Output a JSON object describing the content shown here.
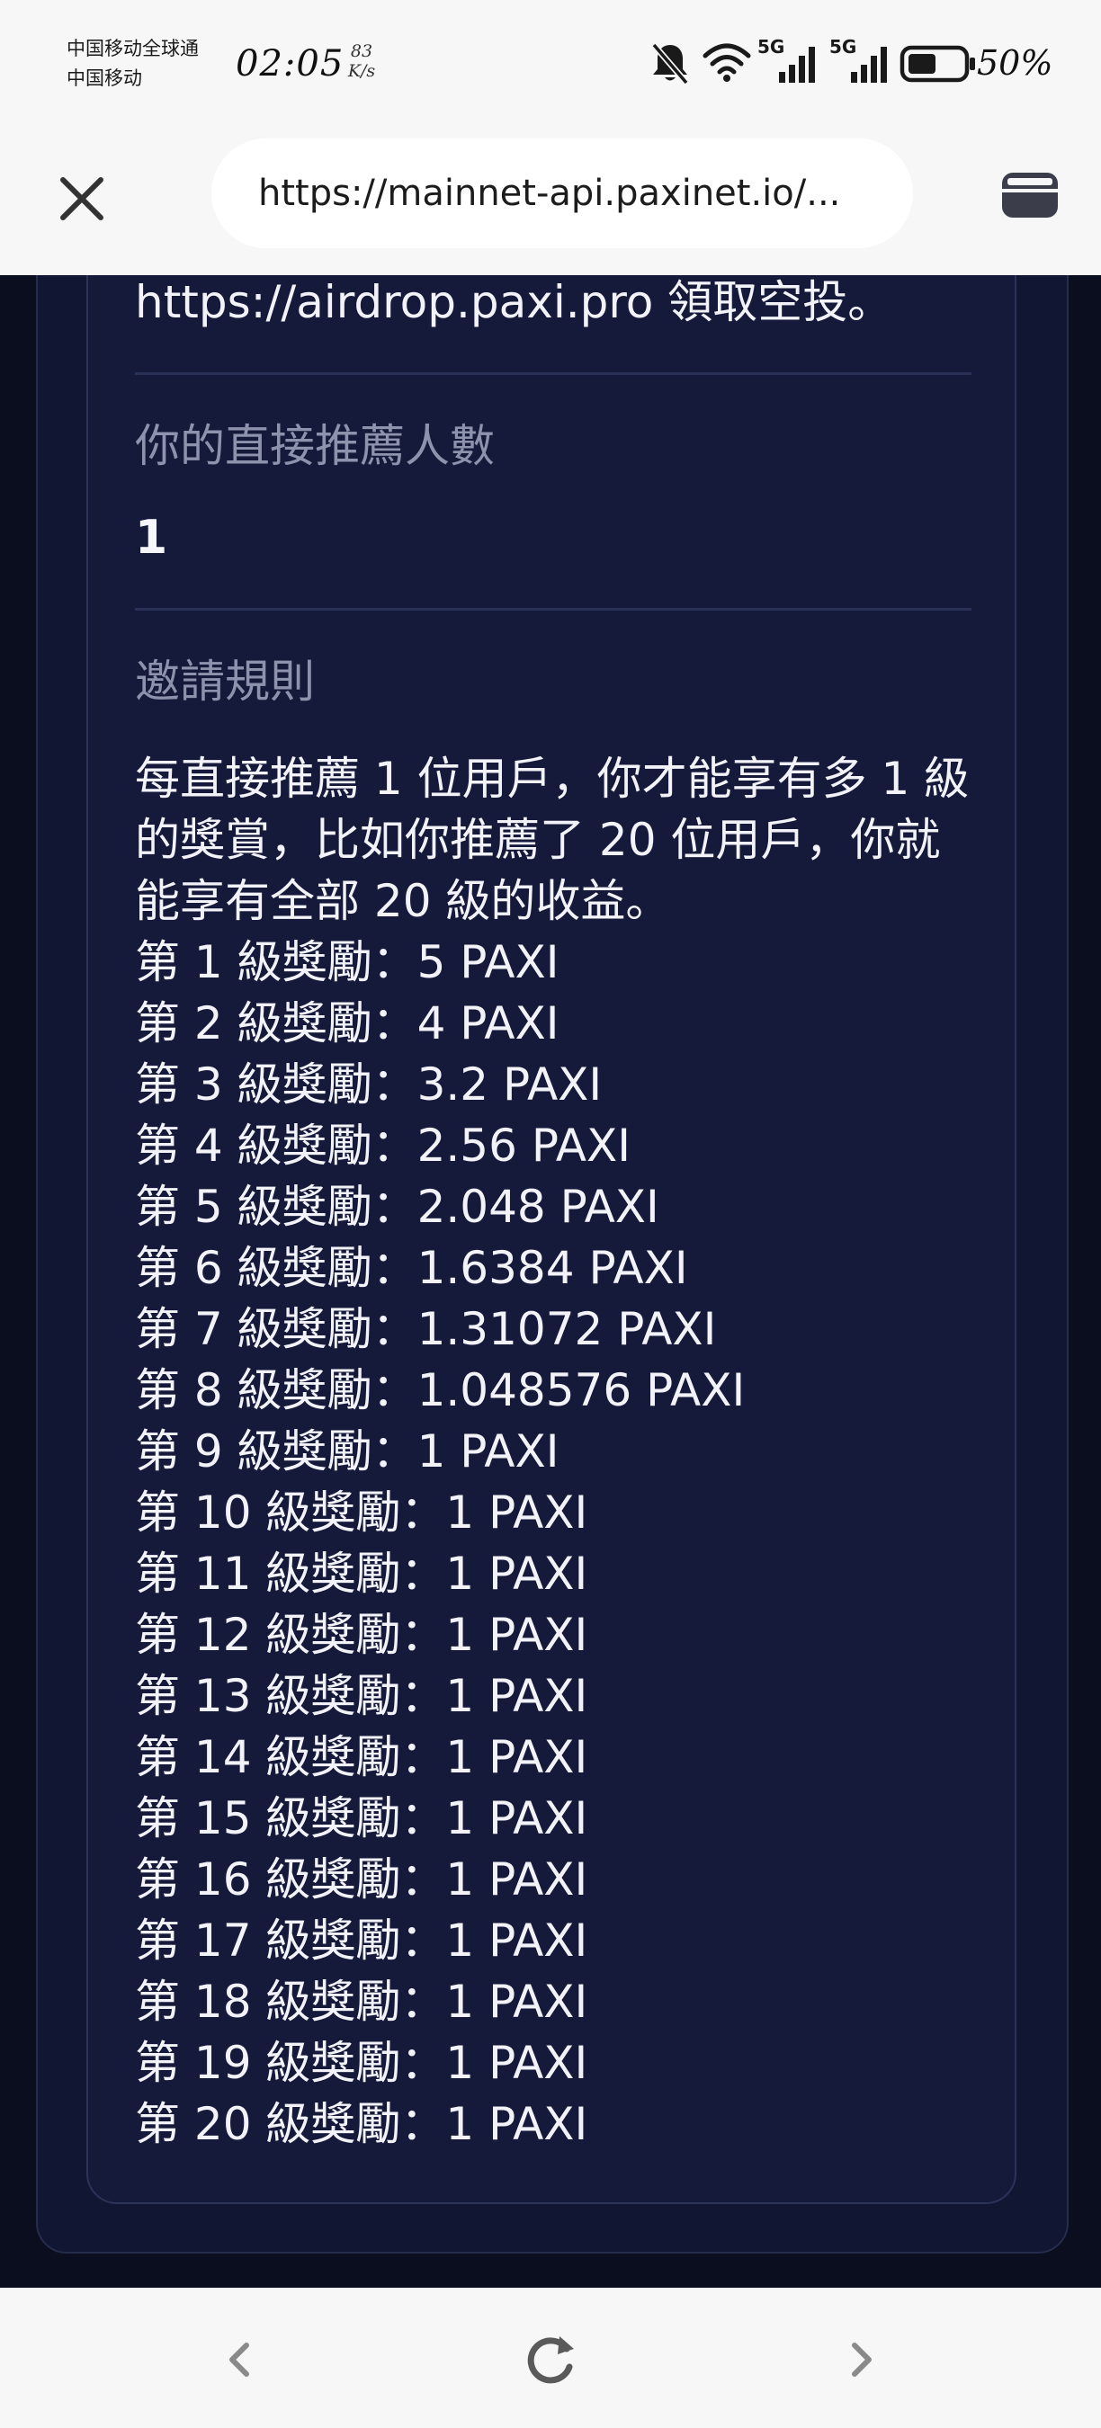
{
  "status_bar": {
    "carrier_1": "中国移动全球通",
    "carrier_2": "中国移动",
    "time": "02:05",
    "net_speed_value": "83",
    "net_speed_unit": "K/s",
    "signal_label_1": "5G",
    "signal_label_2": "5G",
    "battery_percent": "50%",
    "icons": [
      "bell-muted-icon",
      "wifi-icon",
      "signal-icon",
      "signal-icon",
      "battery-icon"
    ]
  },
  "browser": {
    "url": "https://mainnet-api.paxinet.io/...",
    "icons": [
      "close-icon",
      "tabs-icon"
    ]
  },
  "page": {
    "airdrop_text": "https://airdrop.paxi.pro 領取空投。",
    "direct_referrals_label": "你的直接推薦人數",
    "direct_referrals_count": "1",
    "rules_label": "邀請規則",
    "rules_intro": "每直接推薦 1 位用戶，你才能享有多 1 級的獎賞，比如你推薦了 20 位用戶，你就能享有全部 20 級的收益。",
    "rewards": [
      "第 1 級獎勵：5 PAXI",
      "第 2 級獎勵：4 PAXI",
      "第 3 級獎勵：3.2 PAXI",
      "第 4 級獎勵：2.56 PAXI",
      "第 5 級獎勵：2.048 PAXI",
      "第 6 級獎勵：1.6384 PAXI",
      "第 7 級獎勵：1.31072 PAXI",
      "第 8 級獎勵：1.048576 PAXI",
      "第 9 級獎勵：1 PAXI",
      "第 10 級獎勵：1 PAXI",
      "第 11 級獎勵：1 PAXI",
      "第 12 級獎勵：1 PAXI",
      "第 13 級獎勵：1 PAXI",
      "第 14 級獎勵：1 PAXI",
      "第 15 級獎勵：1 PAXI",
      "第 16 級獎勵：1 PAXI",
      "第 17 級獎勵：1 PAXI",
      "第 18 級獎勵：1 PAXI",
      "第 19 級獎勵：1 PAXI",
      "第 20 級獎勵：1 PAXI"
    ]
  },
  "bottom_nav": {
    "icons": [
      "back-icon",
      "reload-icon",
      "forward-icon"
    ]
  },
  "colors": {
    "page_background": "#0b0e1f",
    "card_background": "#161a3a",
    "label_gray": "#8d92ad",
    "text_white": "#f2f3f8",
    "chrome_background": "#f7f7f8"
  }
}
